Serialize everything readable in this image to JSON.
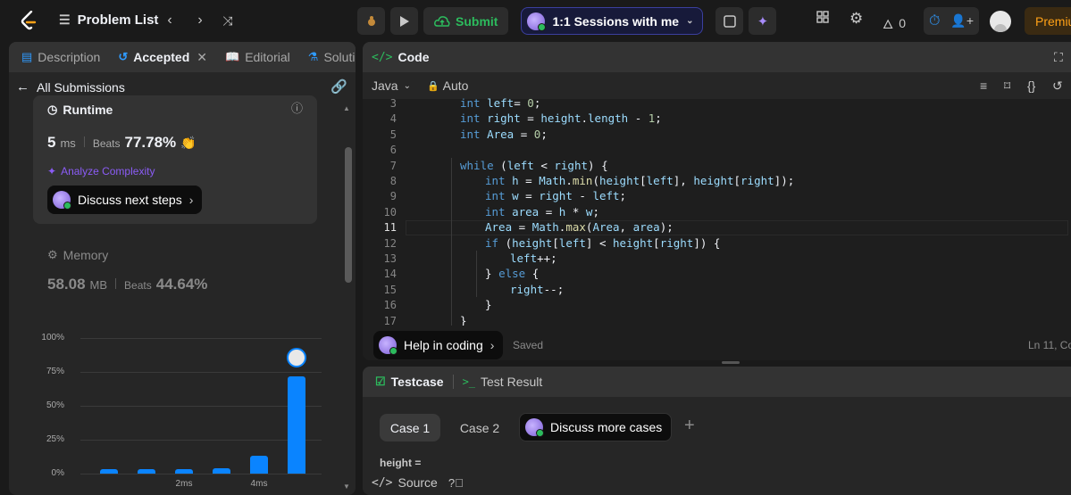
{
  "topbar": {
    "problem_list": "Problem List",
    "submit": "Submit",
    "sessions": "1:1 Sessions with me",
    "fire_count": "0",
    "premium": "Premiu"
  },
  "left_tabs": [
    "Description",
    "Accepted",
    "Editorial",
    "Solutio"
  ],
  "submissions": {
    "back_label": "All Submissions",
    "runtime_label": "Runtime",
    "runtime_value": "5",
    "runtime_unit": "ms",
    "beats_label": "Beats",
    "runtime_beats": "77.78%",
    "analyze": "Analyze Complexity",
    "discuss_next": "Discuss next steps",
    "memory_label": "Memory",
    "memory_value": "58.08",
    "memory_unit": "MB",
    "memory_beats": "44.64%"
  },
  "chart_data": {
    "type": "bar",
    "y_ticks": [
      "100%",
      "75%",
      "50%",
      "25%",
      "0%"
    ],
    "x_ticks": [
      "2ms",
      "4ms"
    ],
    "values": [
      3,
      3,
      3,
      4,
      13,
      72
    ],
    "ylim": [
      0,
      100
    ],
    "highlight_index": 5
  },
  "code": {
    "title": "Code",
    "lang": "Java",
    "auto": "Auto",
    "lines": [
      {
        "n": "3",
        "indent": 2,
        "tokens": [
          [
            "kw",
            "int "
          ],
          [
            "var",
            "left"
          ],
          [
            "",
            "= "
          ],
          [
            "num",
            "0"
          ],
          [
            "",
            ";"
          ]
        ]
      },
      {
        "n": "4",
        "indent": 2,
        "tokens": [
          [
            "kw",
            "int "
          ],
          [
            "var",
            "right"
          ],
          [
            "",
            " = "
          ],
          [
            "var",
            "height"
          ],
          [
            "",
            "."
          ],
          [
            "var",
            "length"
          ],
          [
            "",
            " - "
          ],
          [
            "num",
            "1"
          ],
          [
            "",
            ";"
          ]
        ]
      },
      {
        "n": "5",
        "indent": 2,
        "tokens": [
          [
            "kw",
            "int "
          ],
          [
            "var",
            "Area"
          ],
          [
            "",
            " = "
          ],
          [
            "num",
            "0"
          ],
          [
            "",
            ";"
          ]
        ]
      },
      {
        "n": "6",
        "indent": 0,
        "tokens": []
      },
      {
        "n": "7",
        "indent": 2,
        "tokens": [
          [
            "kw",
            "while "
          ],
          [
            "",
            "("
          ],
          [
            "var",
            "left"
          ],
          [
            "",
            " < "
          ],
          [
            "var",
            "right"
          ],
          [
            "",
            ") {"
          ]
        ]
      },
      {
        "n": "8",
        "indent": 3,
        "tokens": [
          [
            "kw",
            "int "
          ],
          [
            "var",
            "h"
          ],
          [
            "",
            " = "
          ],
          [
            "var",
            "Math"
          ],
          [
            "",
            "."
          ],
          [
            "fn",
            "min"
          ],
          [
            "",
            "("
          ],
          [
            "var",
            "height"
          ],
          [
            "",
            "["
          ],
          [
            "var",
            "left"
          ],
          [
            "",
            "], "
          ],
          [
            "var",
            "height"
          ],
          [
            "",
            "["
          ],
          [
            "var",
            "right"
          ],
          [
            "",
            "]);"
          ]
        ]
      },
      {
        "n": "9",
        "indent": 3,
        "tokens": [
          [
            "kw",
            "int "
          ],
          [
            "var",
            "w"
          ],
          [
            "",
            " = "
          ],
          [
            "var",
            "right"
          ],
          [
            "",
            " - "
          ],
          [
            "var",
            "left"
          ],
          [
            "",
            ";"
          ]
        ]
      },
      {
        "n": "10",
        "indent": 3,
        "tokens": [
          [
            "kw",
            "int "
          ],
          [
            "var",
            "area"
          ],
          [
            "",
            " = "
          ],
          [
            "var",
            "h"
          ],
          [
            "",
            " * "
          ],
          [
            "var",
            "w"
          ],
          [
            "",
            ";"
          ]
        ]
      },
      {
        "n": "11",
        "indent": 3,
        "tokens": [
          [
            "var",
            "Area"
          ],
          [
            "",
            " = "
          ],
          [
            "var",
            "Math"
          ],
          [
            "",
            "."
          ],
          [
            "fn",
            "max"
          ],
          [
            "",
            "("
          ],
          [
            "var",
            "Area"
          ],
          [
            "",
            ", "
          ],
          [
            "var",
            "area"
          ],
          [
            "",
            ");"
          ]
        ]
      },
      {
        "n": "12",
        "indent": 3,
        "tokens": [
          [
            "kw",
            "if "
          ],
          [
            "",
            "("
          ],
          [
            "var",
            "height"
          ],
          [
            "",
            "["
          ],
          [
            "var",
            "left"
          ],
          [
            "",
            "] < "
          ],
          [
            "var",
            "height"
          ],
          [
            "",
            "["
          ],
          [
            "var",
            "right"
          ],
          [
            "",
            "]) {"
          ]
        ]
      },
      {
        "n": "13",
        "indent": 4,
        "tokens": [
          [
            "var",
            "left"
          ],
          [
            "",
            "++;"
          ]
        ]
      },
      {
        "n": "14",
        "indent": 3,
        "tokens": [
          [
            "",
            "} "
          ],
          [
            "kw",
            "else "
          ],
          [
            "",
            "{"
          ]
        ]
      },
      {
        "n": "15",
        "indent": 4,
        "tokens": [
          [
            "var",
            "right"
          ],
          [
            "",
            "--;"
          ]
        ]
      },
      {
        "n": "16",
        "indent": 3,
        "tokens": [
          [
            "",
            "}"
          ]
        ]
      },
      {
        "n": "17",
        "indent": 2,
        "tokens": [
          [
            "",
            "}"
          ]
        ]
      }
    ],
    "help": "Help in coding",
    "saved": "Saved",
    "cursor": "Ln 11, Co"
  },
  "testcase": {
    "tab": "Testcase",
    "result_tab": "Test Result",
    "case1": "Case 1",
    "case2": "Case 2",
    "discuss_more": "Discuss more cases",
    "height_label": "height =",
    "source": "Source"
  }
}
